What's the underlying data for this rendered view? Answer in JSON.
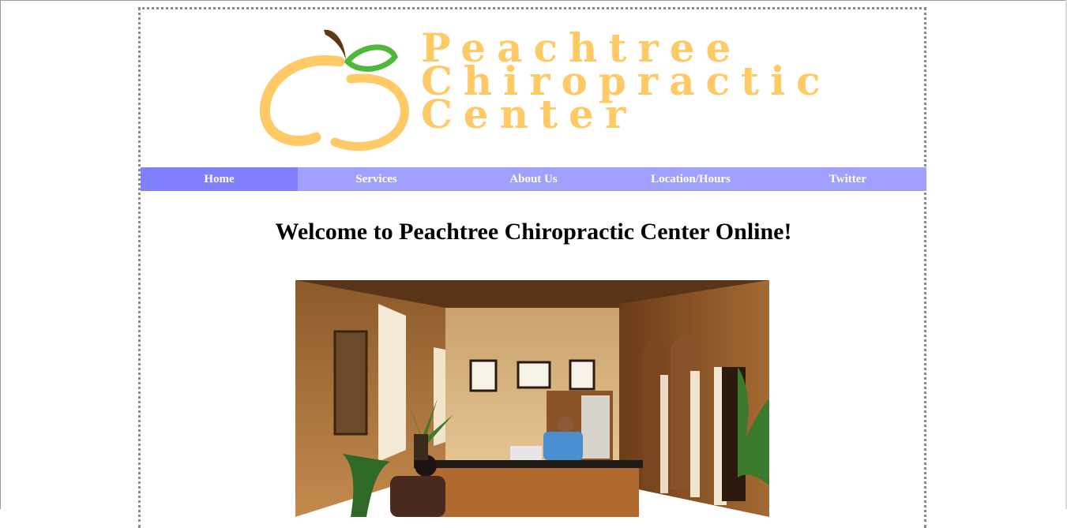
{
  "brand": {
    "line1": "Peachtree",
    "line2": "Chiropractic",
    "line3": "Center",
    "logo_icon": "peach-icon",
    "colors": {
      "peach": "#ffc966",
      "leaf": "#4fb83a",
      "stem": "#5a3a14"
    }
  },
  "nav": {
    "items": [
      {
        "label": "Home",
        "active": true
      },
      {
        "label": "Services"
      },
      {
        "label": "About Us"
      },
      {
        "label": "Location/Hours"
      },
      {
        "label": "Twitter"
      }
    ],
    "colors": {
      "bar": "#a0a0ff",
      "active": "#8080ff",
      "text": "#ffffff"
    }
  },
  "main": {
    "heading": "Welcome to Peachtree Chiropractic Center Online!",
    "photo_subject": "office-reception-photo"
  }
}
